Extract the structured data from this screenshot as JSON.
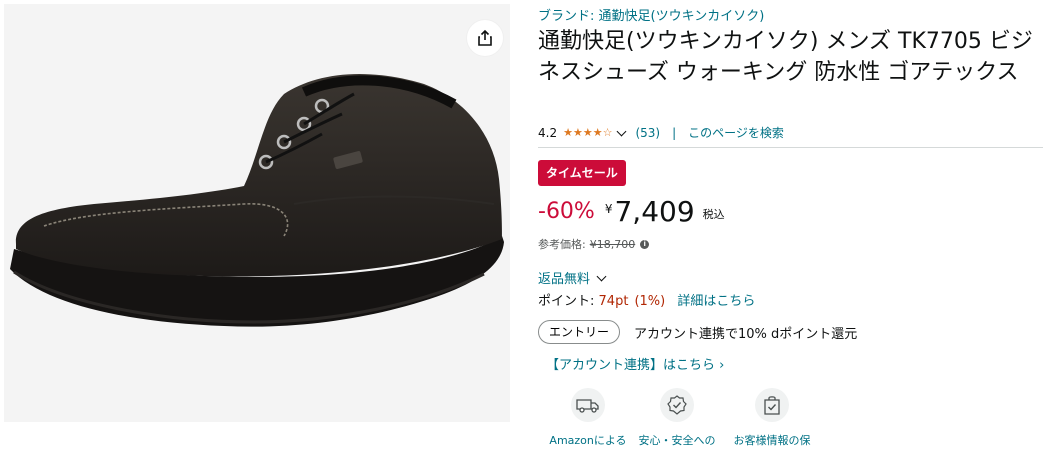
{
  "product": {
    "brand_link": "ブランド: 通勤快足(ツウキンカイソク)",
    "title": "通勤快足(ツウキンカイソク) メンズ TK7705 ビジネスシューズ ウォーキング 防水性 ゴアテックス",
    "image_alt": "黒のビジネスシューズ"
  },
  "rating": {
    "value": "4.2",
    "stars": 4.2,
    "count": "(53)",
    "separator": "|",
    "search_link": "このページを検索"
  },
  "deal": {
    "badge": "タイムセール",
    "discount": "-60%",
    "currency": "¥",
    "price": "7,409",
    "tax_label": "税込",
    "ref_label": "参考価格:",
    "ref_price": "¥18,700"
  },
  "returns": {
    "label": "返品無料"
  },
  "points": {
    "label": "ポイント:",
    "value": "74pt",
    "percent": "(1%)",
    "detail_link": "詳細はこちら"
  },
  "entry": {
    "button": "エントリー",
    "text": "アカウント連携で10% dポイント還元"
  },
  "account_link": "【アカウント連携】はこちら ›",
  "features": [
    {
      "label": "Amazonによる",
      "icon": "delivery-van-icon"
    },
    {
      "label": "安心・安全への",
      "icon": "shield-check-icon"
    },
    {
      "label": "お客様情報の保",
      "icon": "secure-bag-icon"
    }
  ],
  "colors": {
    "link": "#007185",
    "deal_red": "#cc0c39",
    "star": "#de7921",
    "points_red": "#b12704"
  }
}
